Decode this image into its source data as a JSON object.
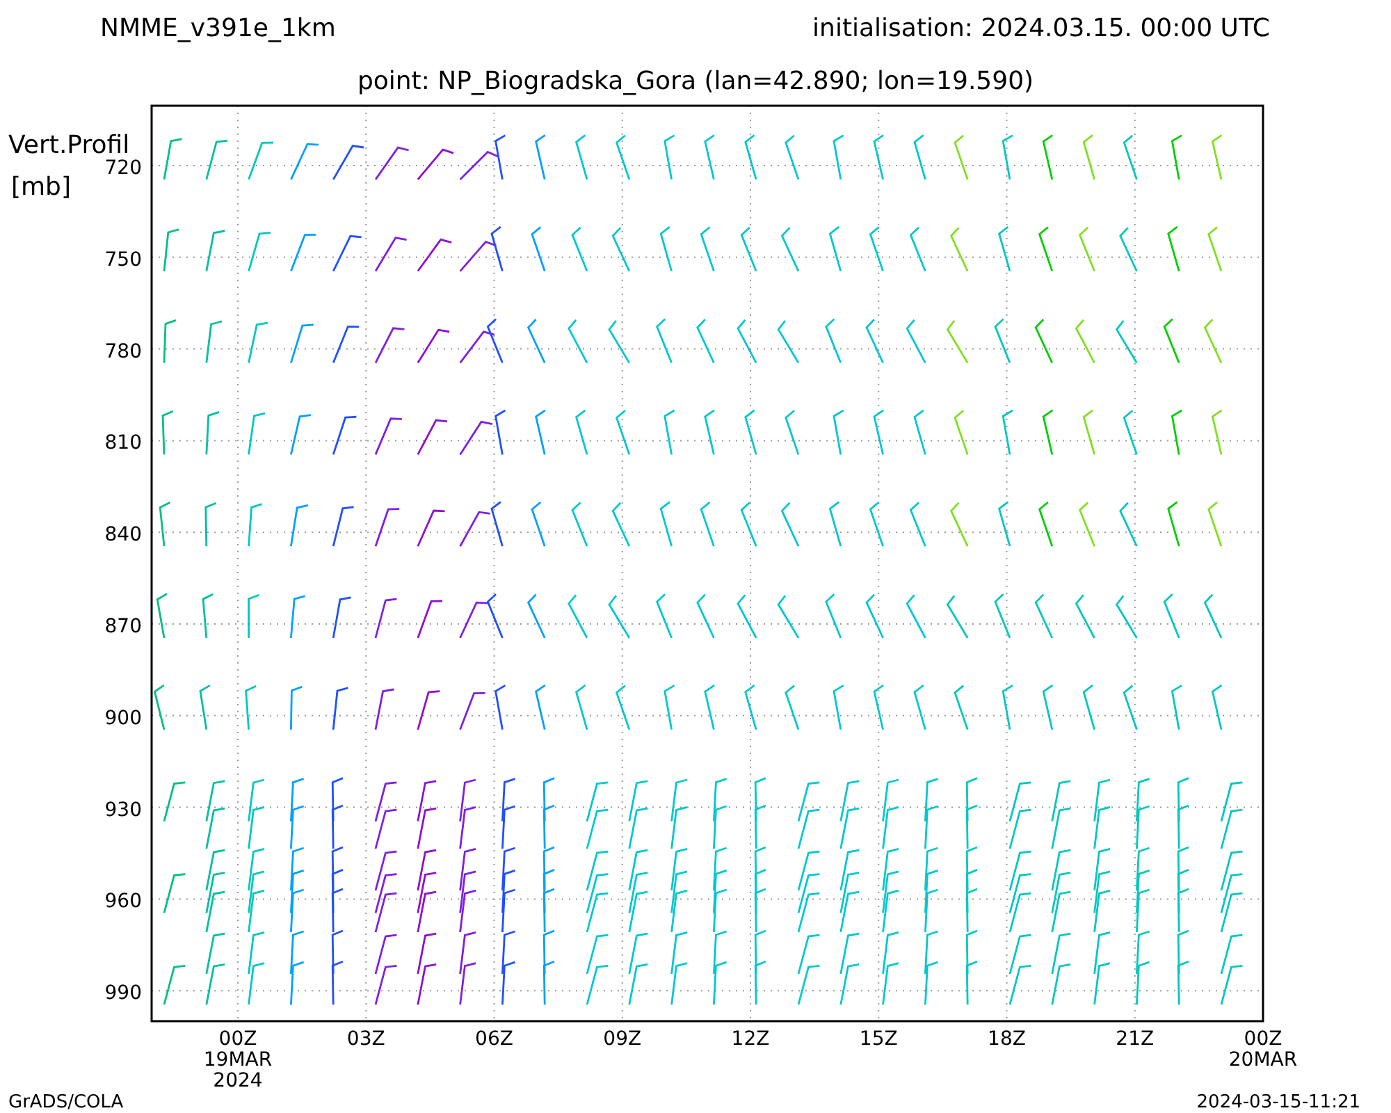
{
  "header": {
    "model": "NMME_v391e_1km",
    "initialisation": "initialisation: 2024.03.15. 00:00 UTC",
    "point": "point: NP_Biogradska_Gora (lan=42.890; lon=19.590)"
  },
  "plot": {
    "ylabel": [
      "Vert.Profil",
      "[mb]"
    ],
    "yticks": [
      "720",
      "750",
      "780",
      "810",
      "840",
      "870",
      "900",
      "930",
      "960",
      "990"
    ],
    "xticks": [
      {
        "label": "00Z",
        "sub": [
          "19MAR",
          "2024"
        ]
      },
      {
        "label": "03Z"
      },
      {
        "label": "06Z"
      },
      {
        "label": "09Z"
      },
      {
        "label": "12Z"
      },
      {
        "label": "15Z"
      },
      {
        "label": "18Z"
      },
      {
        "label": "21Z"
      },
      {
        "label": "00Z",
        "sub": [
          "20MAR"
        ]
      }
    ]
  },
  "footer": {
    "left": "GrADS/COLA",
    "right": "2024-03-15-11:21"
  }
}
